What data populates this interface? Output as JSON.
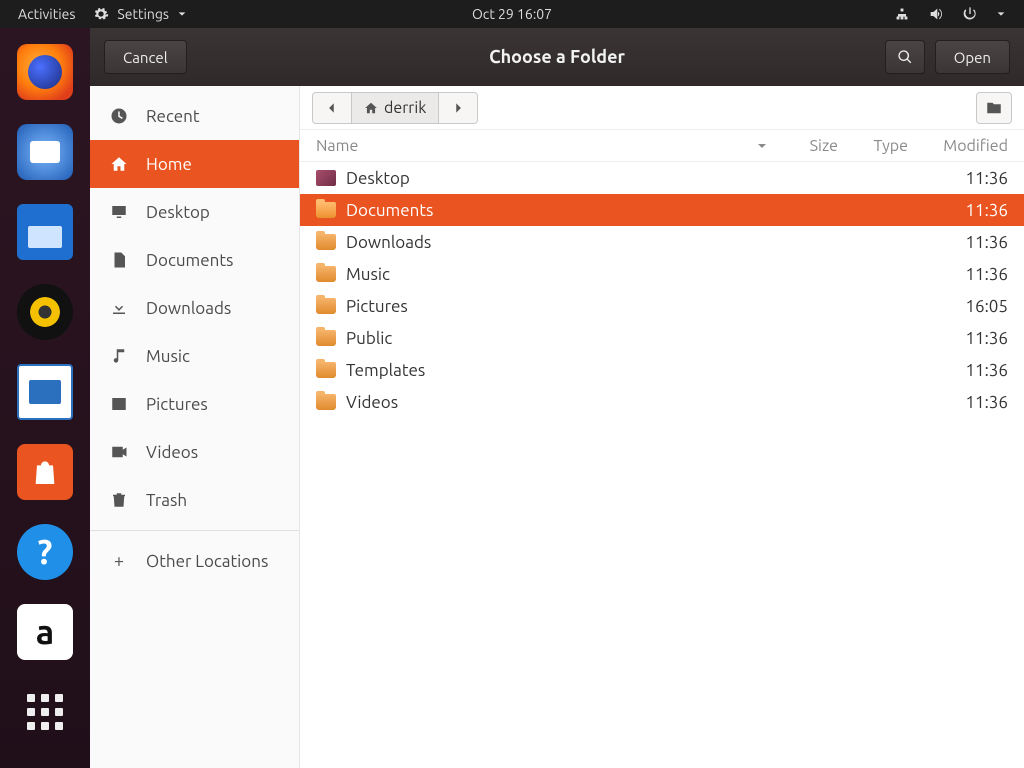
{
  "top_panel": {
    "activities": "Activities",
    "app_menu": "Settings",
    "clock": "Oct 29  16:07"
  },
  "dialog": {
    "title": "Choose a Folder",
    "cancel": "Cancel",
    "open": "Open"
  },
  "sidebar": {
    "items": [
      {
        "id": "recent",
        "label": "Recent"
      },
      {
        "id": "home",
        "label": "Home",
        "active": true
      },
      {
        "id": "desktop",
        "label": "Desktop"
      },
      {
        "id": "documents",
        "label": "Documents"
      },
      {
        "id": "downloads",
        "label": "Downloads"
      },
      {
        "id": "music",
        "label": "Music"
      },
      {
        "id": "pictures",
        "label": "Pictures"
      },
      {
        "id": "videos",
        "label": "Videos"
      },
      {
        "id": "trash",
        "label": "Trash"
      }
    ],
    "other_locations": "Other Locations"
  },
  "path": {
    "current": "derrik"
  },
  "columns": {
    "name": "Name",
    "size": "Size",
    "type": "Type",
    "modified": "Modified"
  },
  "rows": [
    {
      "name": "Desktop",
      "modified": "11:36",
      "icon": "desktop"
    },
    {
      "name": "Documents",
      "modified": "11:36",
      "icon": "folder",
      "selected": true
    },
    {
      "name": "Downloads",
      "modified": "11:36",
      "icon": "folder"
    },
    {
      "name": "Music",
      "modified": "11:36",
      "icon": "folder"
    },
    {
      "name": "Pictures",
      "modified": "16:05",
      "icon": "folder"
    },
    {
      "name": "Public",
      "modified": "11:36",
      "icon": "folder"
    },
    {
      "name": "Templates",
      "modified": "11:36",
      "icon": "folder"
    },
    {
      "name": "Videos",
      "modified": "11:36",
      "icon": "folder"
    }
  ]
}
